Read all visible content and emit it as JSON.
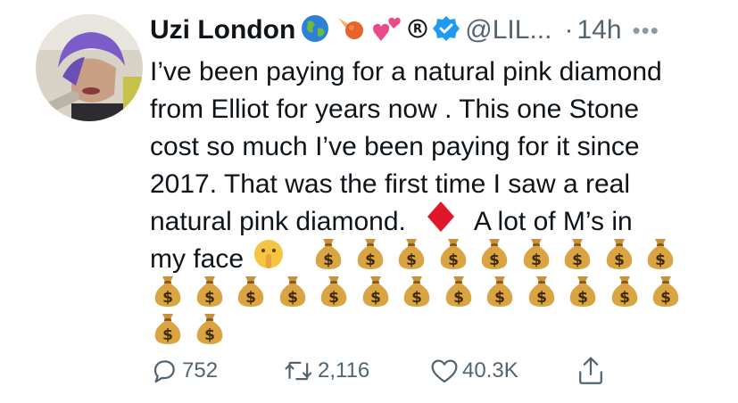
{
  "user": {
    "display_name": "Uzi London",
    "handle": "@LIL...",
    "time": "14h",
    "dot": "·",
    "more": "•••"
  },
  "tweet": {
    "lines": [
      "I’ve been paying for a natural pink diamond",
      "from Elliot for years now . This one Stone",
      "cost so much I’ve been paying for it since",
      "2017. That was the first time I saw a real"
    ],
    "line5_a": "natural pink diamond.",
    "line5_b": "A lot of M’s in",
    "line6": "my face"
  },
  "actions": {
    "replies": "752",
    "retweets": "2,116",
    "likes": "40.3K"
  },
  "colors": {
    "text": "#0f1419",
    "secondary": "#536471",
    "verified": "#1d9bf0",
    "diamond": "#e0162b",
    "bag": "#d9a441"
  },
  "icons": [
    "globe-icon",
    "comet-icon",
    "two-hearts-icon",
    "registered-icon",
    "verified-badge-icon",
    "diamond-icon",
    "shushing-face-icon",
    "money-bag-icon",
    "reply-icon",
    "retweet-icon",
    "like-icon",
    "share-icon"
  ]
}
